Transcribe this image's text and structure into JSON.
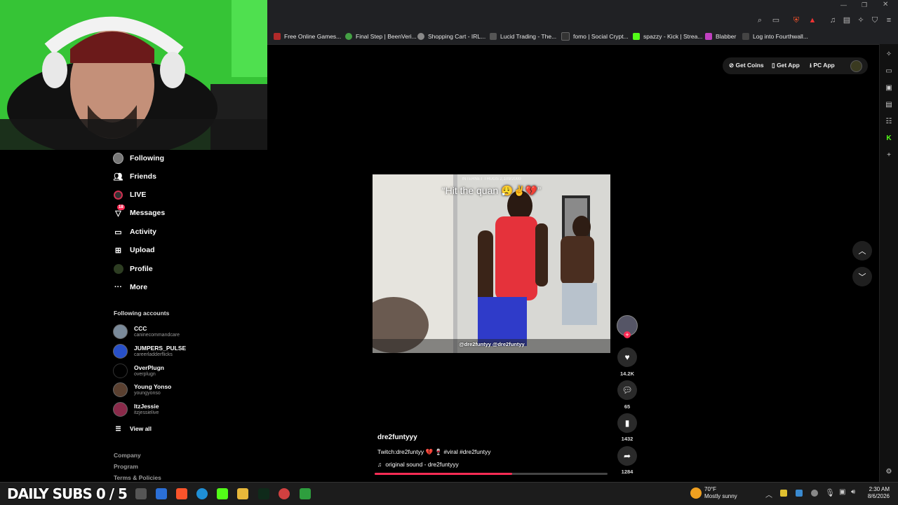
{
  "bookmarks": [
    {
      "label": "Free Online Games...",
      "color": "#b02a2a"
    },
    {
      "label": "Final Step | BeenVeri...",
      "color": "#44a044"
    },
    {
      "label": "Shopping Cart - IRL...",
      "color": "#888888"
    },
    {
      "label": "Lucid Trading - The...",
      "color": "#555555"
    },
    {
      "label": "fomo | Social Crypt...",
      "color": "#333333"
    },
    {
      "label": "spazzy - Kick | Strea...",
      "color": "#53fc18"
    },
    {
      "label": "Blabber",
      "color": "#c040c0"
    },
    {
      "label": "Log into Fourthwall...",
      "color": "#444444"
    }
  ],
  "top_actions": {
    "get_coins": "Get Coins",
    "get_app": "Get App",
    "pc_app": "PC App"
  },
  "nav": [
    {
      "label": "Following",
      "icon": "avatar-icon"
    },
    {
      "label": "Friends",
      "icon": "friends-icon"
    },
    {
      "label": "LIVE",
      "icon": "live-icon"
    },
    {
      "label": "Messages",
      "icon": "messages-icon",
      "badge": "18"
    },
    {
      "label": "Activity",
      "icon": "activity-icon"
    },
    {
      "label": "Upload",
      "icon": "upload-icon"
    },
    {
      "label": "Profile",
      "icon": "profile-icon"
    },
    {
      "label": "More",
      "icon": "more-icon"
    }
  ],
  "following_accounts": {
    "heading": "Following accounts",
    "accounts": [
      {
        "name": "CCC",
        "handle": "caninecommandcare"
      },
      {
        "name": "JUMPERS_PULSE",
        "handle": "careerladderflicks"
      },
      {
        "name": "OverPlugn",
        "handle": "overplugn"
      },
      {
        "name": "Young Yonso",
        "handle": "youngyonso"
      },
      {
        "name": "ItzJessie",
        "handle": "itzjessielive"
      }
    ],
    "view_all": "View all"
  },
  "footer": [
    "Company",
    "Program",
    "Terms & Policies"
  ],
  "video": {
    "caption_overlay": "“Hit the quan 😮‍💨✌️💔”",
    "watermark": "INTERNET THUGS 2,109/2000",
    "handle_overlay": "@dre2funtyy  @dre2funtyy",
    "author": "dre2funtyyy",
    "description": "Twitch:dre2funtyy 💔 🍷 #viral #dre2funtyy",
    "sound": "original sound - dre2funtyyy",
    "progress": 0.59
  },
  "actions": {
    "likes": "14.2K",
    "comments": "65",
    "saves": "1432",
    "shares": "1284"
  },
  "taskbar": {
    "stream_overlay": "DAILY SUBS 0 / 5",
    "weather_temp": "70°F",
    "weather_desc": "Mostly sunny",
    "time": "2:30 AM",
    "date": "8/6/2026"
  }
}
